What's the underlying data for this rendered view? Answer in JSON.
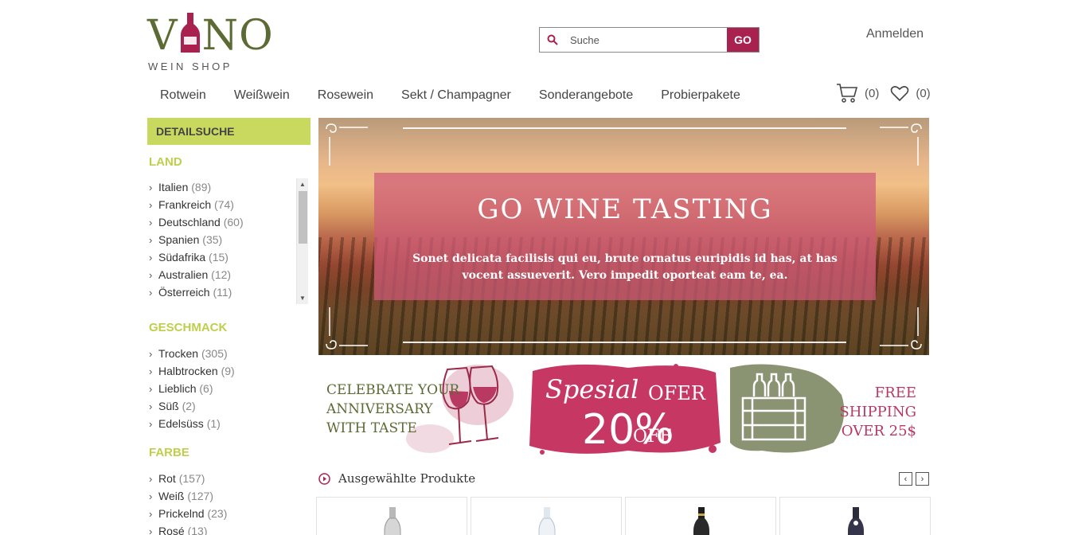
{
  "brand": {
    "name": "V NO",
    "sub": "WEIN SHOP",
    "color": "#5c6a33",
    "bottle_color": "#a9224f"
  },
  "search": {
    "placeholder": "Suche",
    "button": "GO"
  },
  "header": {
    "login": "Anmelden"
  },
  "nav": [
    "Rotwein",
    "Weißwein",
    "Rosewein",
    "Sekt / Champagner",
    "Sonderangebote",
    "Probierpakete"
  ],
  "cart": {
    "count": "(0)"
  },
  "wishlist": {
    "count": "(0)"
  },
  "sidebar": {
    "title": "DETAILSUCHE",
    "land": {
      "title": "LAND",
      "items": [
        {
          "label": "Italien",
          "count": "(89)"
        },
        {
          "label": "Frankreich",
          "count": "(74)"
        },
        {
          "label": "Deutschland",
          "count": "(60)"
        },
        {
          "label": "Spanien",
          "count": "(35)"
        },
        {
          "label": "Südafrika",
          "count": "(15)"
        },
        {
          "label": "Australien",
          "count": "(12)"
        },
        {
          "label": "Österreich",
          "count": "(11)"
        }
      ]
    },
    "geschmack": {
      "title": "GESCHMACK",
      "items": [
        {
          "label": "Trocken",
          "count": "(305)"
        },
        {
          "label": "Halbtrocken",
          "count": "(9)"
        },
        {
          "label": "Lieblich",
          "count": "(6)"
        },
        {
          "label": "Süß",
          "count": "(2)"
        },
        {
          "label": "Edelsüss",
          "count": "(1)"
        }
      ]
    },
    "farbe": {
      "title": "FARBE",
      "items": [
        {
          "label": "Rot",
          "count": "(157)"
        },
        {
          "label": "Weiß",
          "count": "(127)"
        },
        {
          "label": "Prickelnd",
          "count": "(23)"
        },
        {
          "label": "Rosé",
          "count": "(13)"
        }
      ]
    }
  },
  "hero": {
    "title": "GO WINE TASTING",
    "text": "Sonet delicata facilisis qui eu, brute ornatus euripidis id has, at has vocent assueverit. Vero impedit oporteat eam te, ea."
  },
  "promos": {
    "p1": {
      "line1": "CELEBRATE YOUR",
      "line2": "ANNIVERSARY",
      "line3": "WITH TASTE"
    },
    "p2": {
      "script": "Spesial",
      "ofer": "OFER",
      "pct": "20%",
      "off": "OFF"
    },
    "p3": {
      "line1": "FREE",
      "line2": "SHIPPING",
      "line3": "OVER 25$"
    }
  },
  "featured": {
    "title": "Ausgewählte Produkte",
    "prev": "‹",
    "next": "›"
  },
  "colors": {
    "accent": "#a9224f",
    "lime": "#c9d960",
    "olive": "#5c6a33"
  }
}
